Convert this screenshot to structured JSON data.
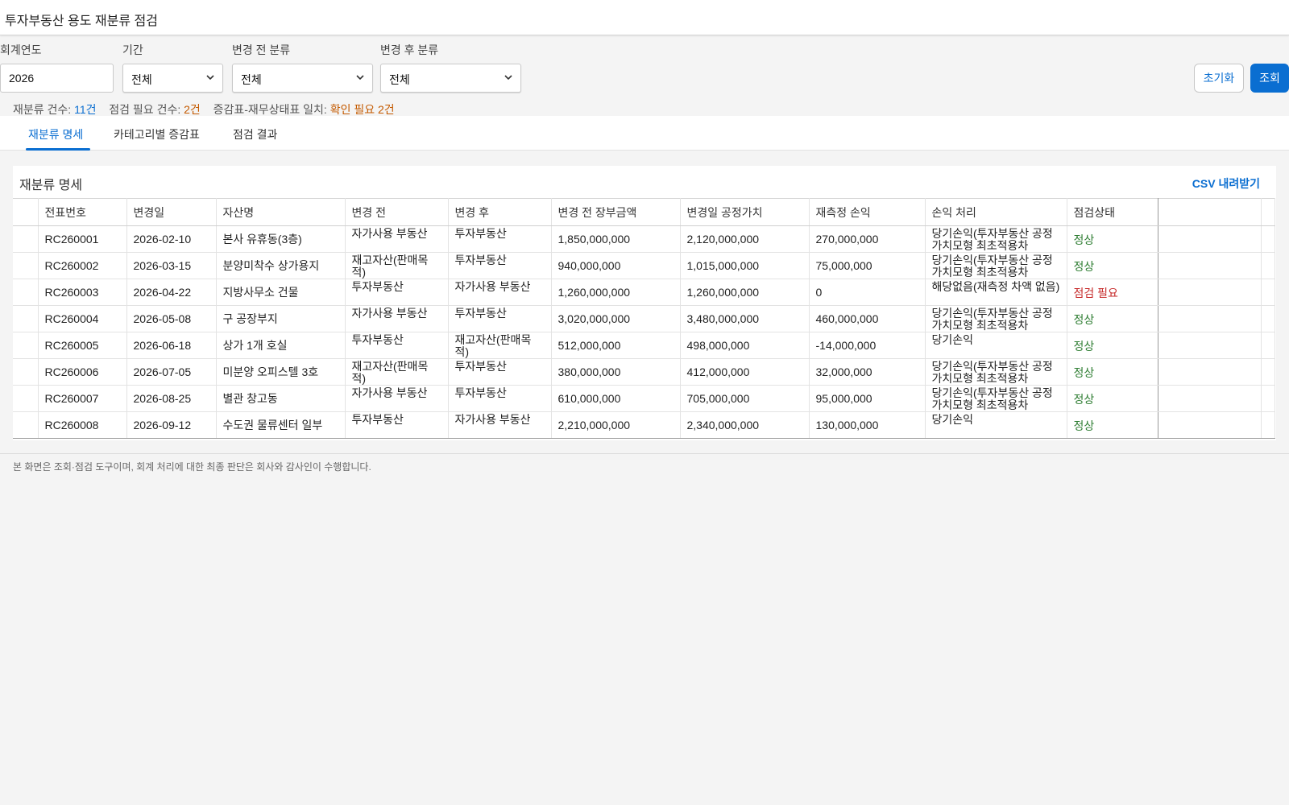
{
  "app": {
    "title": "투자부동산 용도 재분류 점검"
  },
  "filters": {
    "fiscal_year": {
      "label": "회계연도",
      "value": "2026"
    },
    "period": {
      "label": "기간",
      "value": "전체"
    },
    "before_class": {
      "label": "변경 전 분류",
      "value": "전체"
    },
    "after_class": {
      "label": "변경 후 분류",
      "value": "전체"
    },
    "reset_label": "초기화",
    "search_label": "조회"
  },
  "summary": {
    "reclass_count_label": "재분류 건수:",
    "reclass_count": "11건",
    "check_needed_label": "점검 필요 건수:",
    "check_needed": "2건",
    "match_label": "증감표-재무상태표 일치:",
    "match_value": "확인 필요 2건"
  },
  "tabs": [
    {
      "label": "재분류 명세"
    },
    {
      "label": "카테고리별 증감표"
    },
    {
      "label": "점검 결과"
    }
  ],
  "panel": {
    "title": "재분류 명세",
    "csv_label": "CSV 내려받기"
  },
  "table": {
    "headers": [
      "전표번호",
      "변경일",
      "자산명",
      "변경 전",
      "변경 후",
      "변경 전 장부금액",
      "변경일 공정가치",
      "재측정 손익",
      "손익 처리",
      "점검상태"
    ],
    "rows": [
      [
        "RC260001",
        "2026-02-10",
        "본사 유휴동(3층)",
        "자가사용 부동산",
        "투자부동산",
        "1,850,000,000",
        "2,120,000,000",
        "270,000,000",
        "당기손익(투자부동산 공정가치모형 최초적용차",
        "정상"
      ],
      [
        "RC260002",
        "2026-03-15",
        "분양미착수 상가용지",
        "재고자산(판매목적)",
        "투자부동산",
        "940,000,000",
        "1,015,000,000",
        "75,000,000",
        "당기손익(투자부동산 공정가치모형 최초적용차",
        "정상"
      ],
      [
        "RC260003",
        "2026-04-22",
        "지방사무소 건물",
        "투자부동산",
        "자가사용 부동산",
        "1,260,000,000",
        "1,260,000,000",
        "0",
        "해당없음(재측정 차액 없음)",
        "점검 필요"
      ],
      [
        "RC260004",
        "2026-05-08",
        "구 공장부지",
        "자가사용 부동산",
        "투자부동산",
        "3,020,000,000",
        "3,480,000,000",
        "460,000,000",
        "당기손익(투자부동산 공정가치모형 최초적용차",
        "정상"
      ],
      [
        "RC260005",
        "2026-06-18",
        "상가 1개 호실",
        "투자부동산",
        "재고자산(판매목적)",
        "512,000,000",
        "498,000,000",
        "-14,000,000",
        "당기손익",
        "정상"
      ],
      [
        "RC260006",
        "2026-07-05",
        "미분양 오피스텔 3호",
        "재고자산(판매목적)",
        "투자부동산",
        "380,000,000",
        "412,000,000",
        "32,000,000",
        "당기손익(투자부동산 공정가치모형 최초적용차",
        "정상"
      ],
      [
        "RC260007",
        "2026-08-25",
        "별관 창고동",
        "자가사용 부동산",
        "투자부동산",
        "610,000,000",
        "705,000,000",
        "95,000,000",
        "당기손익(투자부동산 공정가치모형 최초적용차",
        "정상"
      ],
      [
        "RC260008",
        "2026-09-12",
        "수도권 물류센터 일부",
        "투자부동산",
        "자가사용 부동산",
        "2,210,000,000",
        "2,340,000,000",
        "130,000,000",
        "당기손익",
        "정상"
      ]
    ]
  },
  "footnote": "본 화면은 조회·점검 도구이며, 회계 처리에 대한 최종 판단은 회사와 감사인이 수행합니다.",
  "colors": {
    "accent": "#0a6ed1",
    "ok": "#2e7d32",
    "warn": "#c62828",
    "orange": "#c45a00"
  },
  "icons": {
    "dropdown": "chevron-down-icon"
  }
}
